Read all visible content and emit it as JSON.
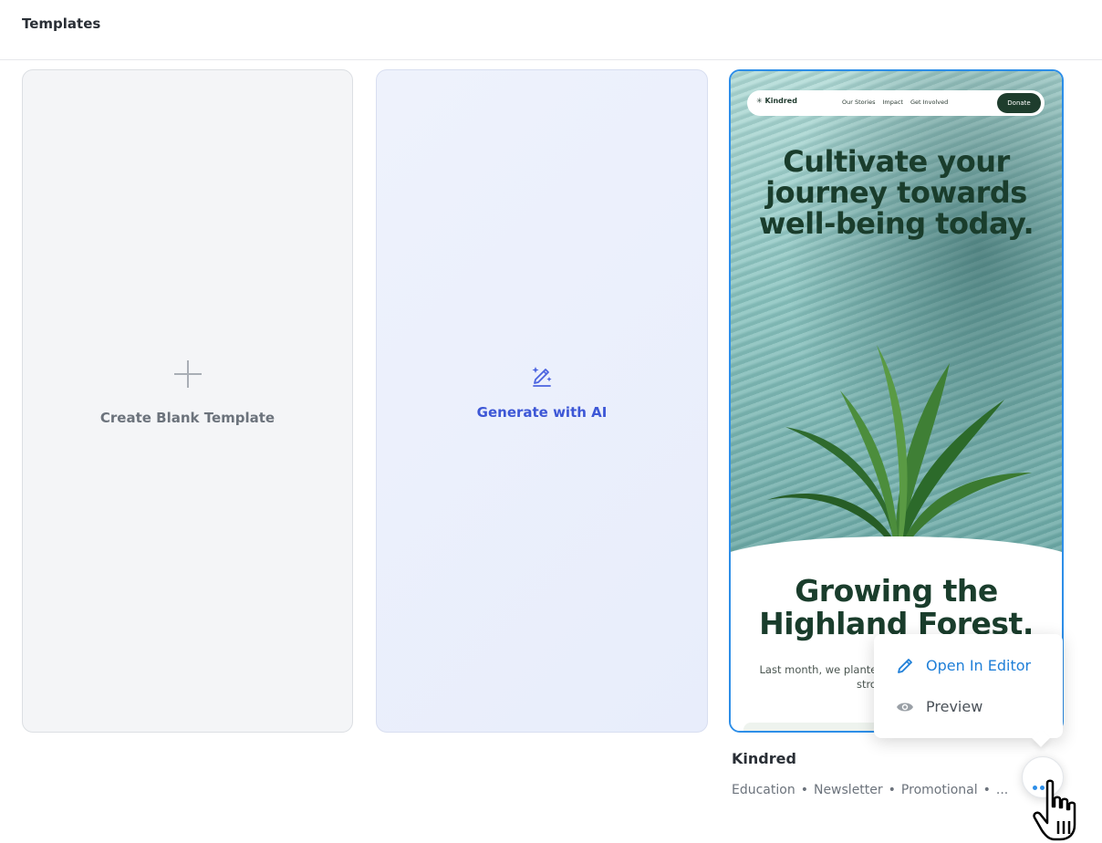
{
  "header": {
    "title": "Templates"
  },
  "cards": {
    "blank": {
      "label": "Create Blank Template",
      "icon": "plus-icon"
    },
    "ai": {
      "label": "Generate with AI",
      "icon": "ai-pencil-sparkle-icon",
      "accent": "#3d57d6"
    }
  },
  "template": {
    "name": "Kindred",
    "tags": [
      "Education",
      "Newsletter",
      "Promotional",
      "..."
    ],
    "preview": {
      "logo": "Kindred",
      "nav_links": [
        "Our Stories",
        "Impact",
        "Get Involved"
      ],
      "donate": "Donate",
      "headline": "Cultivate your journey towards well-being today.",
      "section_title": "Growing the Highland Forest.",
      "body_text": "Last month, we planted 12 the northern ridge, resto stronger conne"
    },
    "border_color": "#2d8ee8"
  },
  "context_menu": {
    "items": [
      {
        "label": "Open In Editor",
        "icon": "pencil-icon"
      },
      {
        "label": "Preview",
        "icon": "eye-icon"
      }
    ]
  },
  "more_button": {
    "icon": "more-dots-icon"
  }
}
